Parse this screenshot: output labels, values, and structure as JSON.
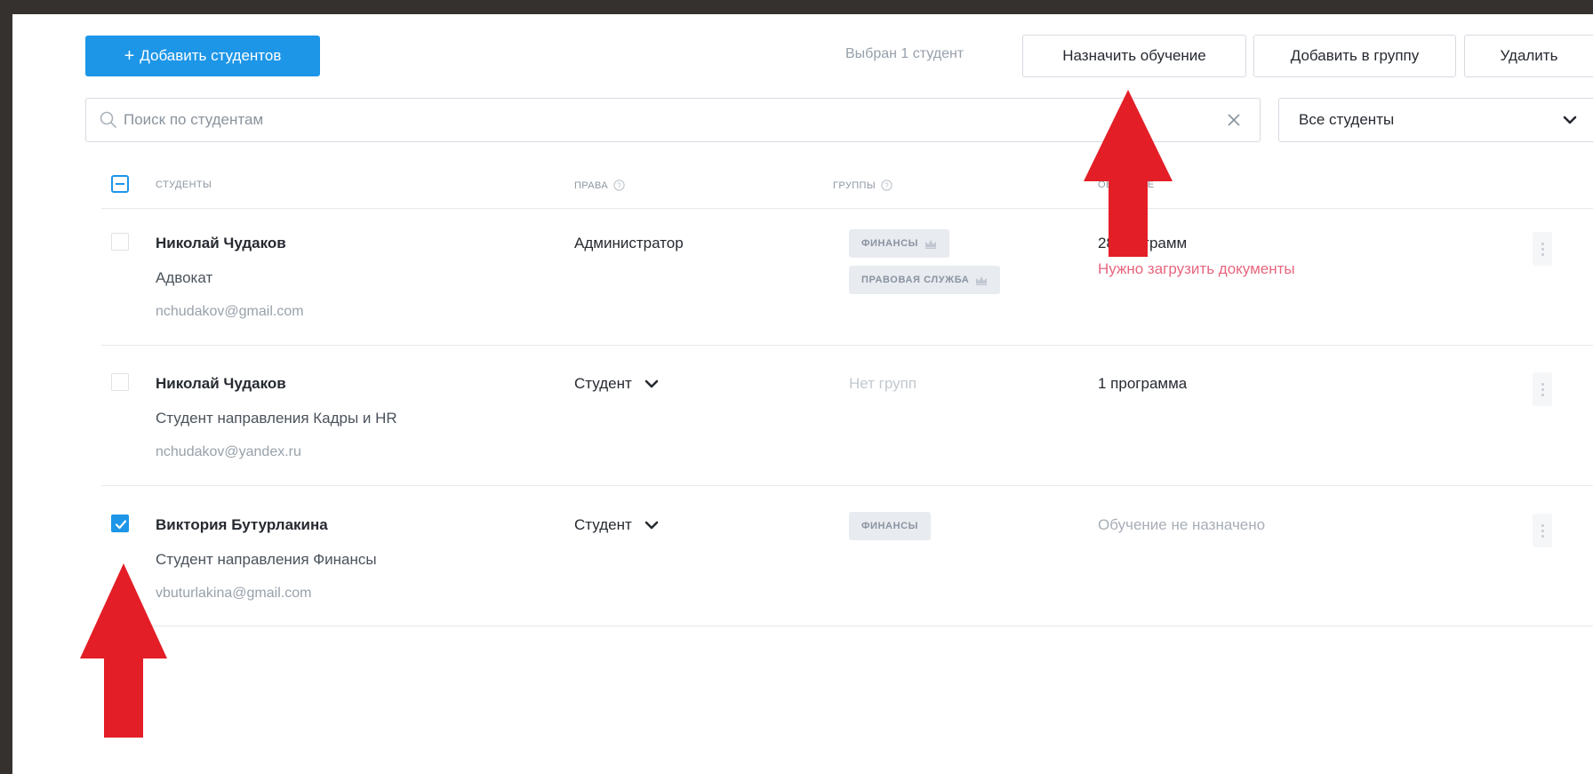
{
  "toolbar": {
    "add_students_plus": "+",
    "add_students_label": "Добавить студентов",
    "selected_text": "Выбран 1 студент",
    "assign_label": "Назначить обучение",
    "add_to_group_label": "Добавить в группу",
    "delete_label": "Удалить"
  },
  "search": {
    "placeholder": "Поиск по студентам",
    "value": ""
  },
  "filter": {
    "selected": "Все студенты"
  },
  "table": {
    "headers": {
      "students": "СТУДЕНТЫ",
      "rights": "ПРАВА",
      "groups": "ГРУППЫ",
      "training": "ОБУЧЕНИЕ"
    },
    "rows": [
      {
        "name": "Николай Чудаков",
        "role": "Адвокат",
        "email": "nchudakov@gmail.com",
        "rights": "Администратор",
        "groups": [
          "ФИНАНСЫ",
          "ПРАВОВАЯ СЛУЖБА"
        ],
        "programs": "28 программ",
        "warning": "Нужно загрузить документы",
        "checked": false
      },
      {
        "name": "Николай Чудаков",
        "role": "Студент направления Кадры и HR",
        "email": "nchudakov@yandex.ru",
        "rights": "Студент",
        "no_groups": "Нет групп",
        "programs": "1 программа",
        "checked": false
      },
      {
        "name": "Виктория Бутурлакина",
        "role": "Студент направления Финансы",
        "email": "vbuturlakina@gmail.com",
        "rights": "Студент",
        "groups": [
          "ФИНАНСЫ"
        ],
        "training_status": "Обучение не назначено",
        "checked": true
      }
    ]
  },
  "icons": {
    "search": "search-icon",
    "clear": "close-icon",
    "dropdown": "chevron-down-icon",
    "help": "help-circle-icon",
    "crown": "crown-icon",
    "menu": "kebab-menu-icon",
    "annotation": "red-arrow-up-icon"
  },
  "colors": {
    "primary": "#1d96e8",
    "warning": "#e7667f",
    "annotation": "#e41e26",
    "background": "#34312e"
  }
}
